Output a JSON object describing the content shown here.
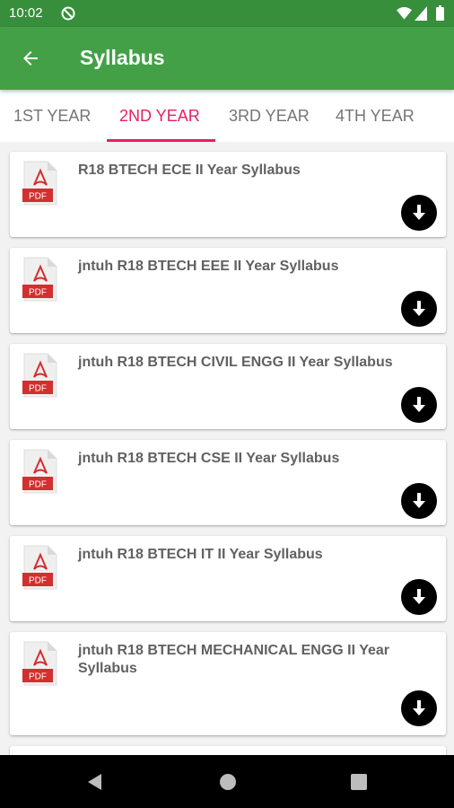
{
  "status_bar": {
    "time": "10:02"
  },
  "app_bar": {
    "title": "Syllabus"
  },
  "tabs": [
    {
      "label": "1ST YEAR",
      "active": false
    },
    {
      "label": "2ND YEAR",
      "active": true
    },
    {
      "label": "3RD YEAR",
      "active": false
    },
    {
      "label": "4TH YEAR",
      "active": false
    }
  ],
  "syllabus_items": [
    {
      "title": "R18 BTECH ECE II Year Syllabus",
      "icon_label": "PDF"
    },
    {
      "title": "jntuh  R18 BTECH EEE II Year Syllabus",
      "icon_label": "PDF"
    },
    {
      "title": "jntuh R18 BTECH CIVIL ENGG II Year Syllabus",
      "icon_label": "PDF"
    },
    {
      "title": "jntuh R18 BTECH CSE II Year Syllabus",
      "icon_label": "PDF"
    },
    {
      "title": "jntuh R18 BTECH IT II Year Syllabus",
      "icon_label": "PDF"
    },
    {
      "title": "jntuh R18 BTECH MECHANICAL ENGG II Year Syllabus",
      "icon_label": "PDF"
    }
  ],
  "icons": {
    "back": "arrow-back-icon",
    "download": "download-icon",
    "file": "pdf-file-icon"
  },
  "colors": {
    "status_bar": "#378f3c",
    "app_bar": "#43a047",
    "tab_active": "#e91e63",
    "tab_inactive": "#757575",
    "pdf_badge": "#d32f2f"
  }
}
